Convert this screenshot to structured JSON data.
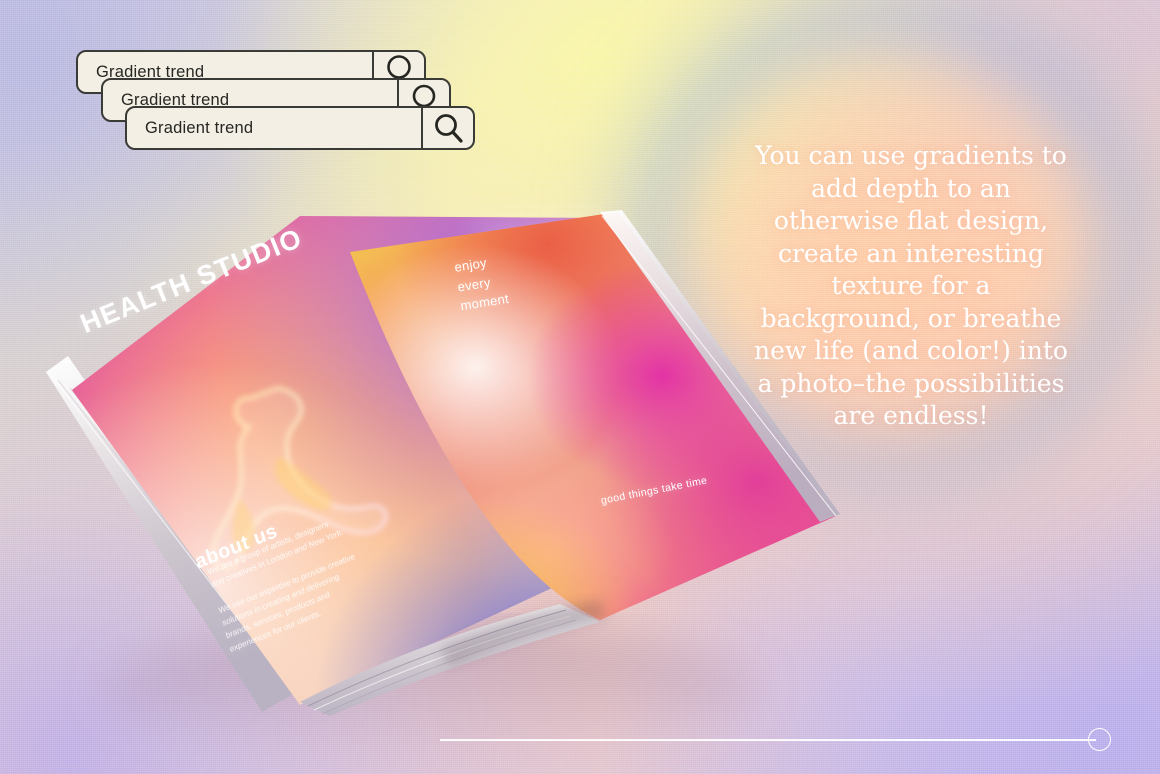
{
  "search_bars": [
    {
      "text": "Gradient trend",
      "icon": "search-icon"
    },
    {
      "text": "Gradient trend",
      "icon": "search-icon"
    },
    {
      "text": "Gradient trend",
      "icon": "search-icon"
    }
  ],
  "quote": {
    "text": "You can use gradients to\nadd depth to an\notherwise flat design,\ncreate an interesting\ntexture for a\nbackground, or breathe\nnew life (and color!) into\na photo–the possibilities\nare endless!"
  },
  "magazine": {
    "left_page": {
      "title": "HEALTH STUDIO",
      "section_heading": "about us",
      "body": "We are a group of artists, designers\nand creatives in London and New York.\n\nWe use our expertise to provide creative\nsolutions in creating and delivering\nbrands, services, products and\nexperiences for our clients."
    },
    "right_page": {
      "caption_top": "enjoy\nevery\nmoment",
      "caption_bottom": "good things take time"
    }
  },
  "slider": {
    "value_label": "",
    "thumb": "slider-thumb"
  },
  "colors": {
    "searchbar_fill": "#f3efe4",
    "searchbar_border": "#3a3a36",
    "quote_text": "#ffffff",
    "bg_yellow": "#faf7aa",
    "bg_lavender": "#c0b0e8",
    "bg_peach": "#ffd6b0",
    "page_magenta": "#e0399b",
    "page_blue": "#3a3fc4"
  }
}
